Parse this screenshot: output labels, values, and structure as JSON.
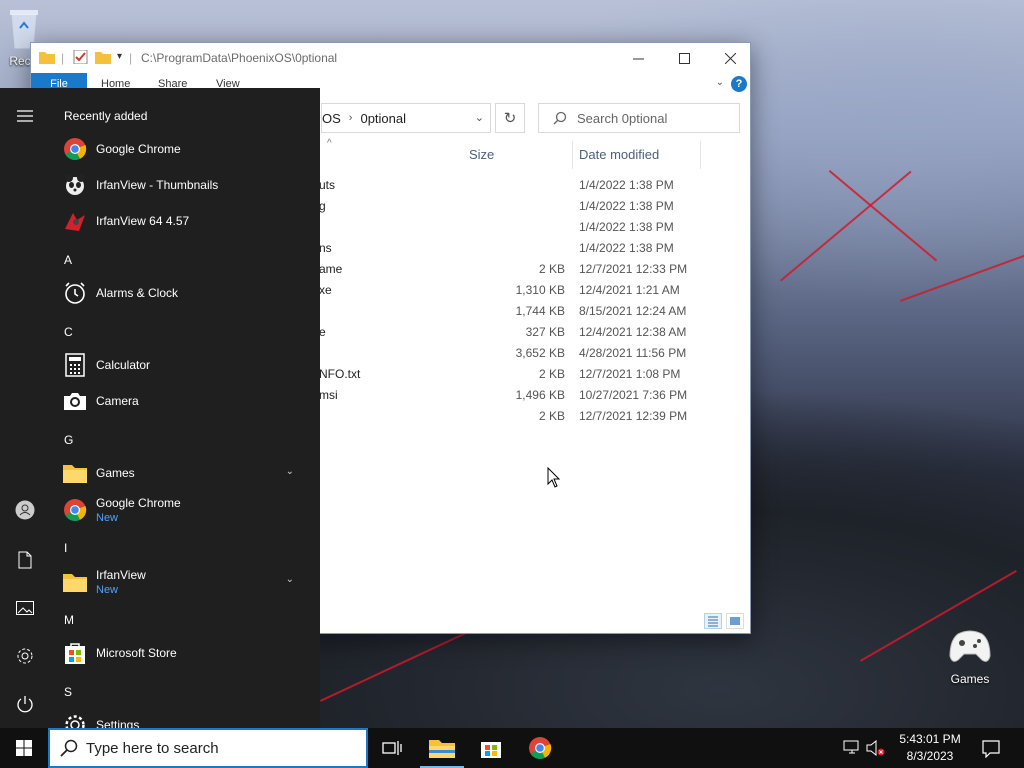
{
  "desktop": {
    "recycle_bin_label": "Rec",
    "games_label": "Games"
  },
  "explorer": {
    "title_path": "C:\\ProgramData\\PhoenixOS\\0ptional",
    "ribbon_tabs": [
      "File",
      "Home",
      "Share",
      "View"
    ],
    "help_label": "?",
    "breadcrumb": [
      "OS",
      "0ptional"
    ],
    "search_placeholder": "Search 0ptional",
    "columns": {
      "size": "Size",
      "date": "Date modified"
    },
    "files": [
      {
        "name": "uts",
        "size": "",
        "date": "1/4/2022 1:38 PM"
      },
      {
        "name": "g",
        "size": "",
        "date": "1/4/2022 1:38 PM"
      },
      {
        "name": "",
        "size": "",
        "date": "1/4/2022 1:38 PM"
      },
      {
        "name": "ns",
        "size": "",
        "date": "1/4/2022 1:38 PM"
      },
      {
        "name": "ame",
        "size": "2 KB",
        "date": "12/7/2021 12:33 PM"
      },
      {
        "name": "xe",
        "size": "1,310 KB",
        "date": "12/4/2021 1:21 AM"
      },
      {
        "name": "",
        "size": "1,744 KB",
        "date": "8/15/2021 12:24 AM"
      },
      {
        "name": "e",
        "size": "327 KB",
        "date": "12/4/2021 12:38 AM"
      },
      {
        "name": "",
        "size": "3,652 KB",
        "date": "4/28/2021 11:56 PM"
      },
      {
        "name": "NFO.txt",
        "size": "2 KB",
        "date": "12/7/2021 1:08 PM"
      },
      {
        "name": "msi",
        "size": "1,496 KB",
        "date": "10/27/2021 7:36 PM"
      },
      {
        "name": "",
        "size": "2 KB",
        "date": "12/7/2021 12:39 PM"
      }
    ]
  },
  "start_menu": {
    "header": "Recently added",
    "recent": [
      {
        "name": "Google Chrome",
        "icon": "chrome-icon"
      },
      {
        "name": "IrfanView - Thumbnails",
        "icon": "irfanview-thumbnails-icon"
      },
      {
        "name": "IrfanView 64 4.57",
        "icon": "irfanview-icon"
      }
    ],
    "sections": {
      "a": "A",
      "c": "C",
      "g": "G",
      "i": "I",
      "m": "M",
      "s": "S"
    },
    "apps": {
      "alarms": "Alarms & Clock",
      "calculator": "Calculator",
      "camera": "Camera",
      "games": "Games",
      "chrome": "Google Chrome",
      "chrome_badge": "New",
      "irfanview": "IrfanView",
      "irfanview_badge": "New",
      "store": "Microsoft Store",
      "settings": "Settings"
    }
  },
  "taskbar": {
    "search_placeholder": "Type here to search",
    "time": "5:43:01 PM",
    "date": "8/3/2023"
  },
  "colors": {
    "accent": "#1979ca",
    "start_bg": "#1f1f1f",
    "taskbar_bg": "#101010",
    "new_badge": "#4aa3ff"
  }
}
